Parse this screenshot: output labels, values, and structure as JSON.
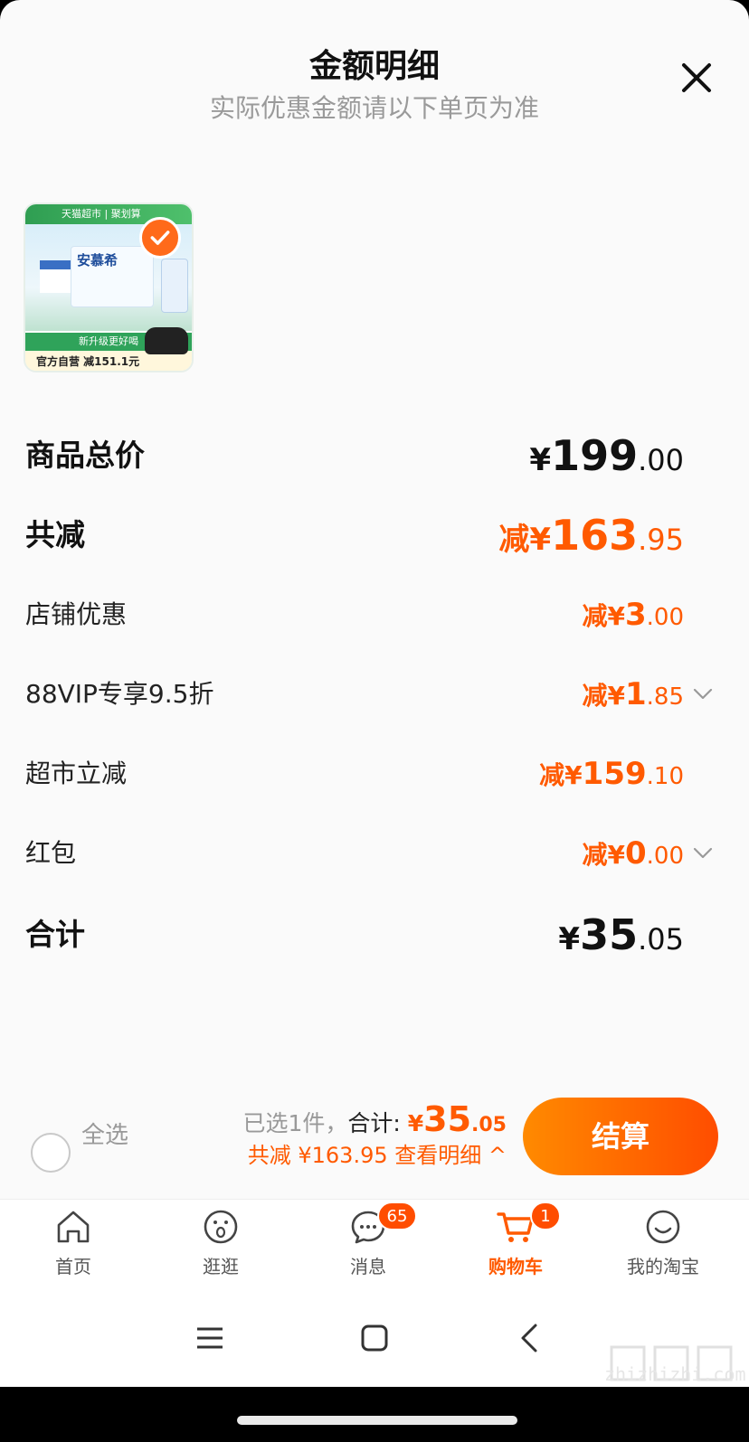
{
  "header": {
    "title": "金额明细",
    "subtitle": "实际优惠金额请以下单页为准"
  },
  "product": {
    "thumb_top": "天猫超市 | 聚划算",
    "brand": "安慕希",
    "promo": "新升级更好喝",
    "footer": "官方自营 减151.1元"
  },
  "rows": {
    "total": {
      "label": "商品总价",
      "prefix": "",
      "currency": "¥",
      "int": "199",
      "dec": ".00"
    },
    "discount_total": {
      "label": "共减",
      "prefix": "减",
      "currency": "¥",
      "int": "163",
      "dec": ".95"
    },
    "store": {
      "label": "店铺优惠",
      "prefix": "减",
      "currency": "¥",
      "int": "3",
      "dec": ".00"
    },
    "vip": {
      "label": "88VIP专享9.5折",
      "prefix": "减",
      "currency": "¥",
      "int": "1",
      "dec": ".85"
    },
    "market": {
      "label": "超市立减",
      "prefix": "减",
      "currency": "¥",
      "int": "159",
      "dec": ".10"
    },
    "redpacket": {
      "label": "红包",
      "prefix": "减",
      "currency": "¥",
      "int": "0",
      "dec": ".00"
    },
    "sum": {
      "label": "合计",
      "prefix": "",
      "currency": "¥",
      "int": "35",
      "dec": ".05"
    }
  },
  "bottom_bar": {
    "select_all": "全选",
    "selected_count": "已选1件，",
    "sum_label": "合计: ",
    "currency": "¥",
    "sum_int": "35",
    "sum_dec": ".05",
    "discount_line": "共减 ¥163.95  查看明细 ^",
    "checkout": "结算"
  },
  "tabs": [
    {
      "label": "首页",
      "icon": "home-icon"
    },
    {
      "label": "逛逛",
      "icon": "stroll-icon"
    },
    {
      "label": "消息",
      "icon": "message-icon",
      "badge": "65"
    },
    {
      "label": "购物车",
      "icon": "cart-icon",
      "badge": "1",
      "active": true
    },
    {
      "label": "我的淘宝",
      "icon": "profile-icon"
    }
  ],
  "colors": {
    "accent": "#ff5a00",
    "checkout_gradient_start": "#ff8a00",
    "checkout_gradient_end": "#ff4d00"
  },
  "watermark": "zhizhizhi.com"
}
